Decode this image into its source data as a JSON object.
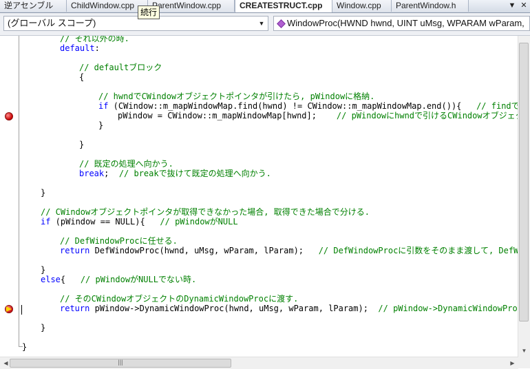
{
  "tabs": [
    {
      "label": "逆アセンブル",
      "active": false
    },
    {
      "label": "ChildWindow.cpp",
      "active": false
    },
    {
      "label": "ParentWindow.cpp",
      "active": false
    },
    {
      "label": "CREATESTRUCT.cpp",
      "active": true
    },
    {
      "label": "Window.cpp",
      "active": false
    },
    {
      "label": "ParentWindow.h",
      "active": false
    }
  ],
  "tab_controls": {
    "dropdown": "▼",
    "close": "✕"
  },
  "tooltip": "続行",
  "navbar": {
    "scope_value": "(グローバル スコープ)",
    "member_value": "WindowProc(HWND hwnd, UINT uMsg, WPARAM wParam,"
  },
  "code": {
    "l0": {
      "cm": "// それ以外の時."
    },
    "l1": {
      "kw": "default",
      "text": ":"
    },
    "l3": {
      "cm": "// defaultブロック"
    },
    "l4": {
      "text": "{"
    },
    "l6": {
      "cm": "// hwndでCWindowオブジェクトポインタが引けたら, pWindowに格納."
    },
    "l7": {
      "kw": "if",
      "text": " (CWindow::m_mapWindowMap.find(hwnd) != CWindow::m_mapWindowMap.end()){   ",
      "cm": "// findでキー"
    },
    "l8": {
      "text": "pWindow = CWindow::m_mapWindowMap[hwnd];    ",
      "cm": "// pWindowにhwndで引けるCWindowオブジェク"
    },
    "l9": {
      "text": "}"
    },
    "l11": {
      "text": "}"
    },
    "l13": {
      "cm": "// 既定の処理へ向かう."
    },
    "l14": {
      "kw": "break",
      "text": ";  ",
      "cm": "// breakで抜けて既定の処理へ向かう."
    },
    "l16": {
      "text": "}"
    },
    "l18": {
      "cm": "// CWindowオブジェクトポインタが取得できなかった場合, 取得できた場合で分ける."
    },
    "l19": {
      "kw": "if",
      "text": " (pWindow == NULL){   ",
      "cm": "// pWindowがNULL"
    },
    "l21": {
      "cm": "// DefWindowProcに任せる."
    },
    "l22": {
      "kw": "return",
      "text": " DefWindowProc(hwnd, uMsg, wParam, lParam);   ",
      "cm": "// DefWindowProcに引数をそのまま渡して, DefW"
    },
    "l24": {
      "text": "}"
    },
    "l25": {
      "kw": "else",
      "text": "{   ",
      "cm": "// pWindowがNULLでない時."
    },
    "l27": {
      "cm": "// そのCWindowオブジェクトのDynamicWindowProcに渡す."
    },
    "l28": {
      "kw": "return",
      "text": " pWindow->DynamicWindowProc(hwnd, uMsg, wParam, lParam);  ",
      "cm": "// pWindow->DynamicWindowProcに引"
    },
    "l30": {
      "text": "}"
    },
    "l32": {
      "text": "}"
    }
  },
  "scrollbar": {
    "up": "▲",
    "down": "▼",
    "left": "◀",
    "right": "▶",
    "grip": "|||"
  }
}
